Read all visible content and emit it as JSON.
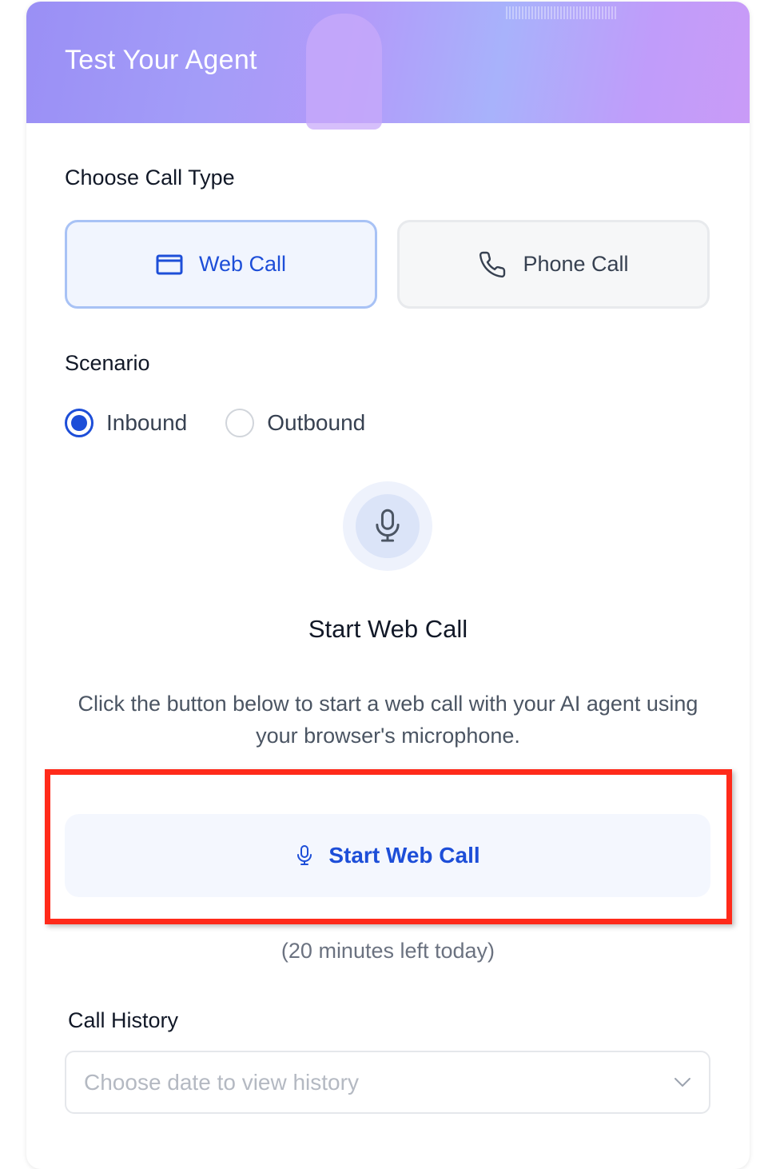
{
  "header": {
    "title": "Test Your Agent"
  },
  "call_type": {
    "label": "Choose Call Type",
    "options": [
      {
        "label": "Web Call",
        "icon": "browser-window-icon",
        "selected": true
      },
      {
        "label": "Phone Call",
        "icon": "phone-icon",
        "selected": false
      }
    ]
  },
  "scenario": {
    "label": "Scenario",
    "options": [
      {
        "label": "Inbound",
        "selected": true
      },
      {
        "label": "Outbound",
        "selected": false
      }
    ]
  },
  "main": {
    "mic_icon": "microphone-icon",
    "title": "Start Web Call",
    "description": "Click the button below to start a web call with your AI agent using your browser's microphone.",
    "start_button_label": "Start Web Call",
    "minutes_left": "(20 minutes left today)"
  },
  "history": {
    "label": "Call History",
    "placeholder": "Choose date to view history",
    "icon": "chevron-down-icon"
  },
  "colors": {
    "accent": "#1d4ed8",
    "highlight_border": "#ff2a1a"
  }
}
